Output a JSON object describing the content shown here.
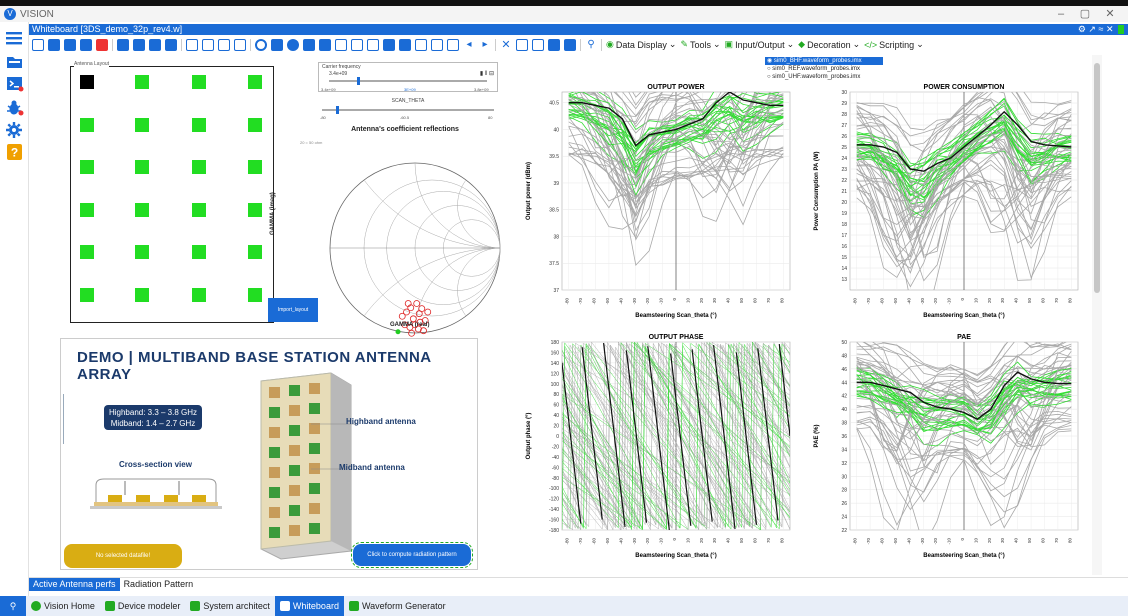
{
  "app": {
    "title": "VISION",
    "window_controls": [
      "–",
      "▢",
      "✕"
    ]
  },
  "whiteboard": {
    "title": "Whiteboard [3DS_demo_32p_rev4.w]",
    "header_icons": [
      "gear-icon",
      "pin-icon",
      "collapse-icon",
      "close-icon"
    ]
  },
  "sidebar": {
    "items": [
      {
        "name": "menu-icon",
        "color": "#1a6bd6"
      },
      {
        "name": "folder-icon",
        "color": "#1a6bd6"
      },
      {
        "name": "terminal-icon",
        "color": "#1a6bd6"
      },
      {
        "name": "bug-icon",
        "color": "#1a6bd6"
      },
      {
        "name": "gear-icon",
        "color": "#1a6bd6"
      },
      {
        "name": "help-icon",
        "color": "#f0a000"
      }
    ]
  },
  "toolbar": {
    "menus": [
      {
        "label": "Data Display",
        "icon": "eye-icon"
      },
      {
        "label": "Tools",
        "icon": "wrench-icon"
      },
      {
        "label": "Input/Output",
        "icon": "io-icon"
      },
      {
        "label": "Decoration",
        "icon": "tag-icon"
      },
      {
        "label": "Scripting",
        "icon": "code-icon"
      }
    ]
  },
  "antenna_layout": {
    "caption": "Antenna Layout",
    "import_button": "Import_layout"
  },
  "carrier_frequency": {
    "label": "Carrier frequency",
    "value": "3.4e+09",
    "ticks": [
      "3.4e+09",
      "3.6e+09",
      "3.8e+09"
    ],
    "mid_tick": "3E+09"
  },
  "scan_theta": {
    "label": "SCAN_THETA",
    "ticks": [
      "-80",
      "-60.5",
      "80"
    ]
  },
  "smith_chart": {
    "title": "Antenna's coefficient reflections",
    "corner_note": "20 = 50 ohm",
    "xlabel": "GAMMA (real)",
    "ylabel": "GAMMA (imag)"
  },
  "file_list": {
    "selected": 0,
    "items": [
      "sim0_BHF.waveform_probes.imx",
      "sim0_REF.waveform_probes.imx",
      "sim0_UHF.waveform_probes.imx"
    ]
  },
  "demo": {
    "title": "DEMO | MULTIBAND BASE STATION ANTENNA ARRAY",
    "bands": [
      "Highband: 3.3 – 3.8 GHz",
      "Midband: 1.4 – 2.7 GHz"
    ],
    "cross_section": "Cross-section view",
    "highband_label": "Highband antenna",
    "midband_label": "Midband antenna",
    "no_data_button": "No selected datafile!",
    "compute_button": "Click to compute radiation pattern"
  },
  "chart_data": [
    {
      "type": "line",
      "title": "OUTPUT POWER",
      "xlabel": "Beamsteering Scan_theta (°)",
      "ylabel": "Output power (dBm)",
      "ylim": [
        37,
        40.7
      ],
      "yticks": [
        37,
        37.5,
        38,
        38.5,
        39,
        39.5,
        40,
        40.5
      ],
      "x": [
        -80,
        -70,
        -60,
        -50,
        -40,
        -30,
        -20,
        -10,
        0,
        10,
        20,
        30,
        40,
        50,
        60,
        70,
        80
      ],
      "series": [
        {
          "role": "selected",
          "color": "#111111",
          "values": [
            40.5,
            40.5,
            40.45,
            40.4,
            40.2,
            39.7,
            39.9,
            39.95,
            40.0,
            40.1,
            40.2,
            40.5,
            40.7,
            40.55,
            40.5,
            40.45,
            40.45
          ]
        }
      ]
    },
    {
      "type": "line",
      "title": "POWER CONSUMPTION",
      "xlabel": "Beamsteering Scan_theta (°)",
      "ylabel": "Power Consumption PA (W)",
      "ylim": [
        12,
        30
      ],
      "yticks": [
        13,
        14,
        15,
        16,
        17,
        18,
        19,
        20,
        21,
        22,
        23,
        24,
        25,
        26,
        27,
        28,
        29,
        30
      ],
      "x": [
        -80,
        -70,
        -60,
        -50,
        -40,
        -30,
        -20,
        -10,
        0,
        10,
        20,
        30,
        40,
        50,
        60,
        70,
        80
      ],
      "series": [
        {
          "role": "selected",
          "color": "#111111",
          "values": [
            25.2,
            25.2,
            25.0,
            24.5,
            23.0,
            22.8,
            23.5,
            24.0,
            25.0,
            26.0,
            27.0,
            28.2,
            27.0,
            25.5,
            25.2,
            25.1,
            25.0
          ]
        }
      ]
    },
    {
      "type": "line",
      "title": "OUTPUT PHASE",
      "xlabel": "Beamsteering Scan_theta (°)",
      "ylabel": "Output phase (°)",
      "ylim": [
        -180,
        180
      ],
      "yticks": [
        -180,
        -160,
        -140,
        -120,
        -100,
        -80,
        -60,
        -40,
        -20,
        0,
        20,
        40,
        60,
        80,
        100,
        120,
        140,
        160,
        180
      ],
      "x": [
        -80,
        -70,
        -60,
        -50,
        -40,
        -30,
        -20,
        -10,
        0,
        10,
        20,
        30,
        40,
        50,
        60,
        70,
        80
      ],
      "series": []
    },
    {
      "type": "line",
      "title": "PAE",
      "xlabel": "Beamsteering Scan_theta (°)",
      "ylabel": "PAE (%)",
      "ylim": [
        22,
        50
      ],
      "yticks": [
        22,
        24,
        26,
        28,
        30,
        32,
        34,
        36,
        38,
        40,
        42,
        44,
        46,
        48,
        50
      ],
      "x": [
        -80,
        -70,
        -60,
        -50,
        -40,
        -30,
        -20,
        -10,
        0,
        10,
        20,
        30,
        40,
        50,
        60,
        70,
        80
      ],
      "series": [
        {
          "role": "selected",
          "color": "#111111",
          "values": [
            44.0,
            44.0,
            43.5,
            43.0,
            42.5,
            41.0,
            40.3,
            40.0,
            39.5,
            38.5,
            40.0,
            43.5,
            45.5,
            44.5,
            44.0,
            43.8,
            43.8
          ]
        }
      ]
    }
  ],
  "subtabs": [
    "Active Antenna perfs",
    "Radiation Pattern"
  ],
  "bottom_tabs": [
    {
      "label": "Vision Home",
      "icon": "home-icon",
      "color": "#22aa22"
    },
    {
      "label": "Device modeler",
      "icon": "device-icon",
      "color": "#22aa22"
    },
    {
      "label": "System architect",
      "icon": "system-icon",
      "color": "#22aa22"
    },
    {
      "label": "Whiteboard",
      "icon": "whiteboard-icon",
      "color": "#1a6bd6"
    },
    {
      "label": "Waveform Generator",
      "icon": "waveform-icon",
      "color": "#22aa22"
    }
  ],
  "colors": {
    "accent": "#1a6bd6",
    "green": "#33dd33",
    "grey_traces": "#a8a8a8",
    "navy": "#1b3a6b",
    "yellow": "#d9ad13"
  }
}
